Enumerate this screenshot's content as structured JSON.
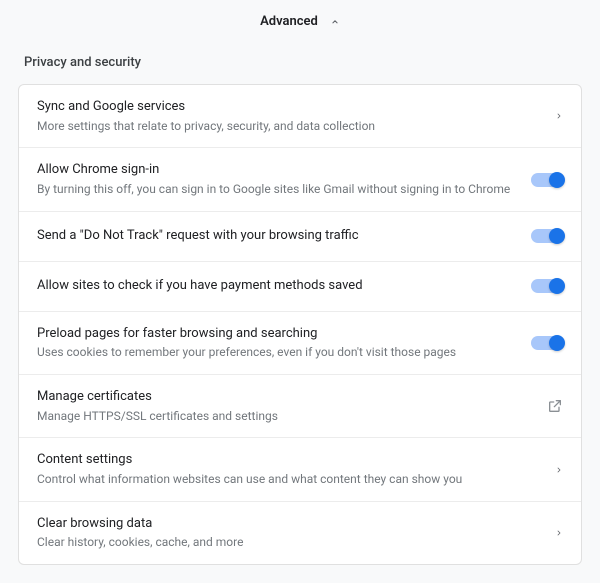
{
  "advanced": {
    "label": "Advanced",
    "expanded": true
  },
  "section": {
    "title": "Privacy and security"
  },
  "rows": {
    "sync": {
      "title": "Sync and Google services",
      "sub": "More settings that relate to privacy, security, and data collection"
    },
    "signin": {
      "title": "Allow Chrome sign-in",
      "sub": "By turning this off, you can sign in to Google sites like Gmail without signing in to Chrome",
      "toggle": true
    },
    "dnt": {
      "title": "Send a \"Do Not Track\" request with your browsing traffic",
      "toggle": true
    },
    "payment": {
      "title": "Allow sites to check if you have payment methods saved",
      "toggle": true
    },
    "preload": {
      "title": "Preload pages for faster browsing and searching",
      "sub": "Uses cookies to remember your preferences, even if you don't visit those pages",
      "toggle": true
    },
    "certs": {
      "title": "Manage certificates",
      "sub": "Manage HTTPS/SSL certificates and settings"
    },
    "content": {
      "title": "Content settings",
      "sub": "Control what information websites can use and what content they can show you"
    },
    "clear": {
      "title": "Clear browsing data",
      "sub": "Clear history, cookies, cache, and more"
    }
  },
  "icons": {
    "chevron_up": "chevron-up-icon",
    "chevron_right": "chevron-right-icon",
    "external": "open-external-icon"
  },
  "colors": {
    "toggle_track_on": "#a8c7fa",
    "toggle_thumb_on": "#1a73e8",
    "border": "#e0e0e0",
    "text_secondary": "#72777c"
  }
}
